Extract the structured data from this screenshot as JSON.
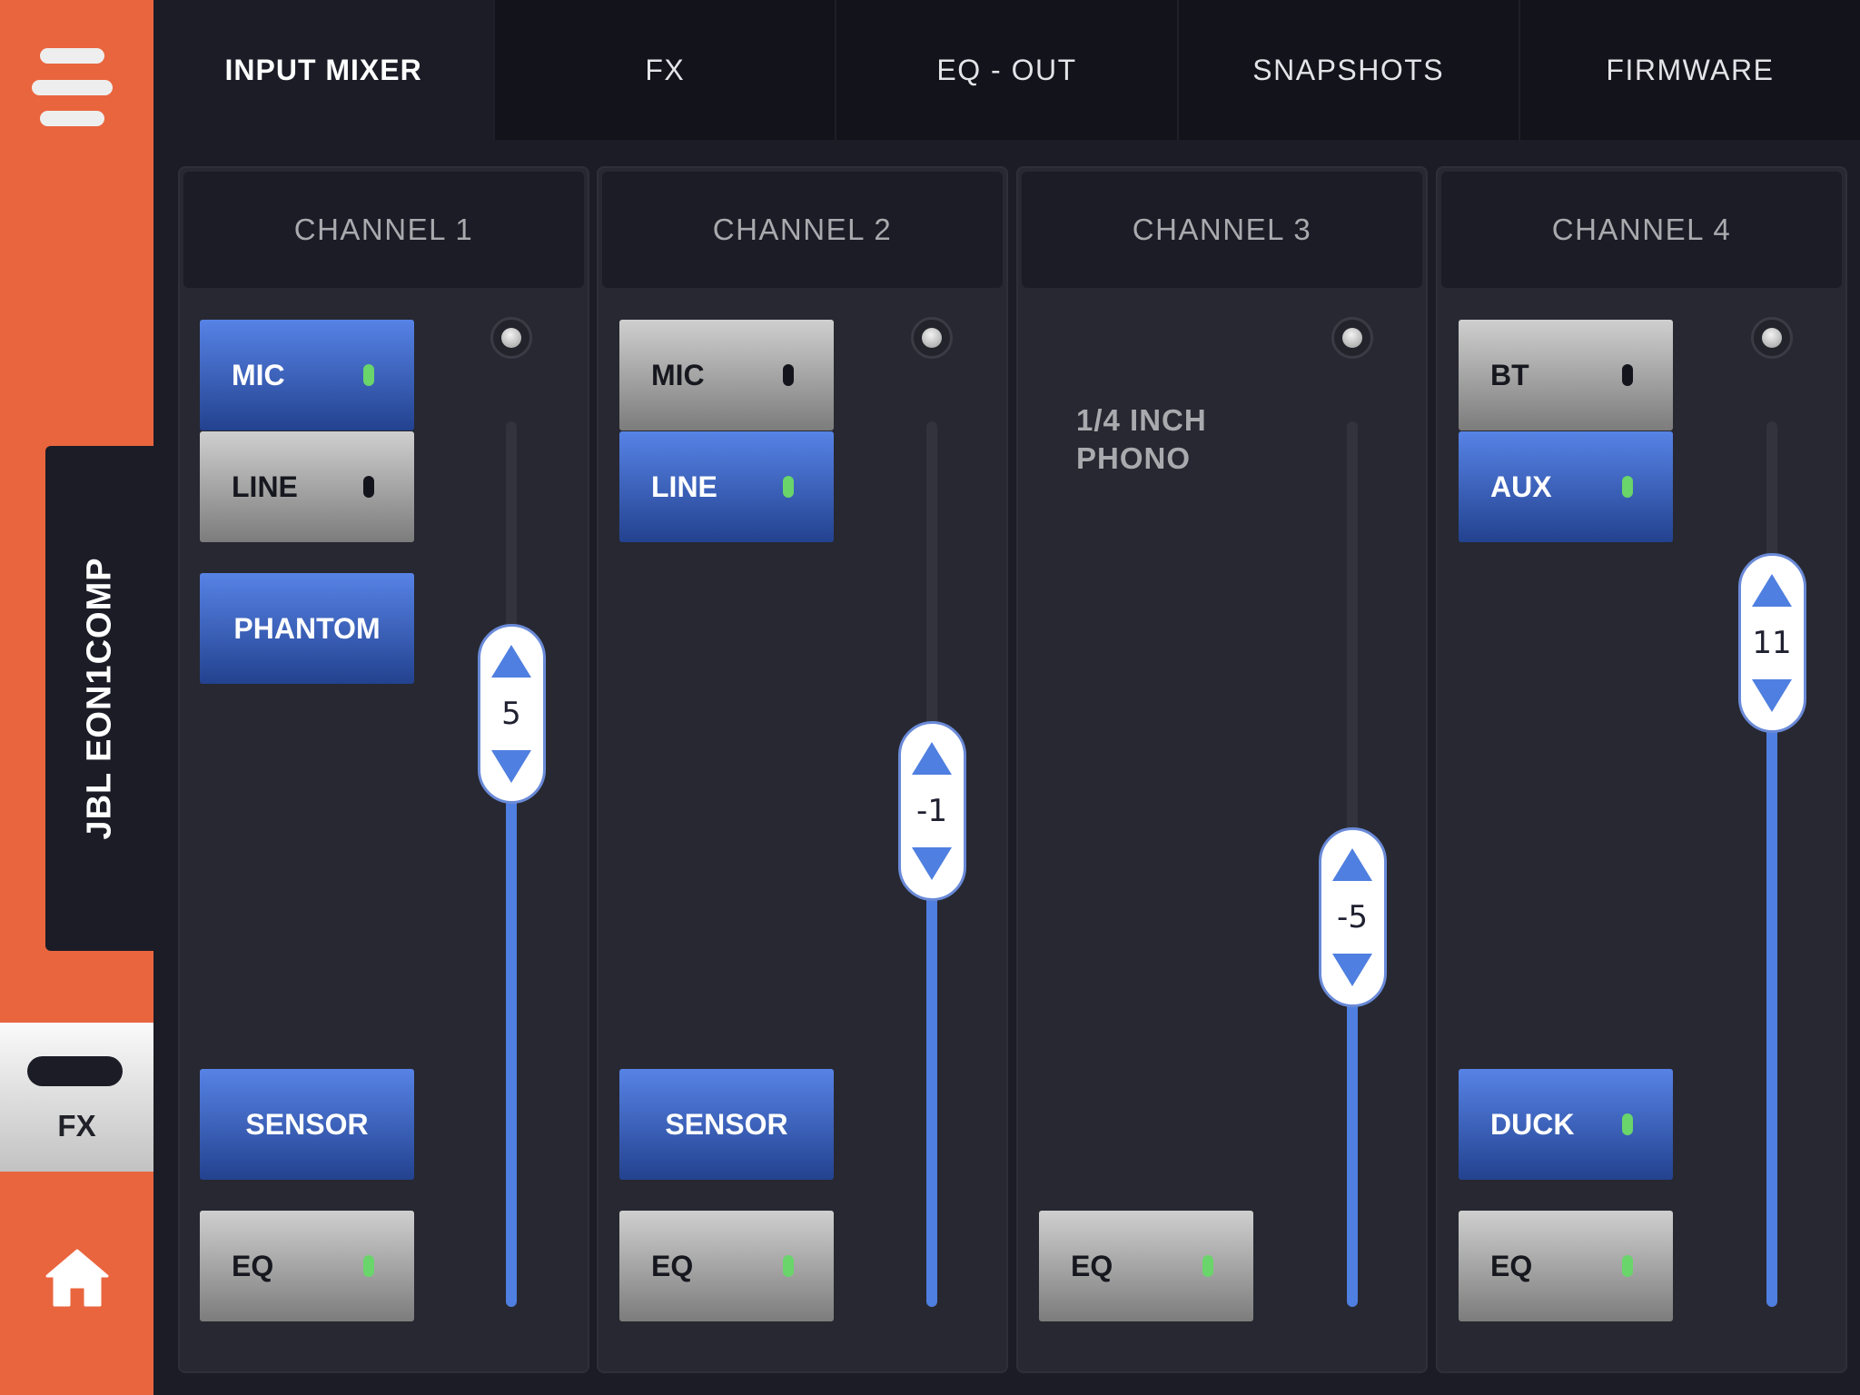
{
  "sidebar": {
    "device_name": "JBL EON1COMP",
    "fx_label": "FX",
    "accent_color": "#e9653e"
  },
  "tabs": [
    {
      "label": "INPUT MIXER",
      "active": true
    },
    {
      "label": "FX",
      "active": false
    },
    {
      "label": "EQ - OUT",
      "active": false
    },
    {
      "label": "SNAPSHOTS",
      "active": false
    },
    {
      "label": "FIRMWARE",
      "active": false
    }
  ],
  "channels": [
    {
      "title": "CHANNEL 1",
      "buttons": {
        "mic": {
          "label": "MIC",
          "on": true
        },
        "line": {
          "label": "LINE",
          "on": false
        },
        "phantom": {
          "label": "PHANTOM",
          "on": true
        },
        "sensor": {
          "label": "SENSOR",
          "on": true
        },
        "eq": {
          "label": "EQ",
          "on": false,
          "led": "green"
        }
      },
      "fader": {
        "value": "5",
        "level_fraction": 0.67
      }
    },
    {
      "title": "CHANNEL 2",
      "buttons": {
        "mic": {
          "label": "MIC",
          "on": false
        },
        "line": {
          "label": "LINE",
          "on": true
        },
        "sensor": {
          "label": "SENSOR",
          "on": true
        },
        "eq": {
          "label": "EQ",
          "on": false,
          "led": "green"
        }
      },
      "fader": {
        "value": "-1",
        "level_fraction": 0.56
      }
    },
    {
      "title": "CHANNEL 3",
      "input_label_line1": "1/4 INCH",
      "input_label_line2": "PHONO",
      "buttons": {
        "eq": {
          "label": "EQ",
          "on": false,
          "led": "green"
        }
      },
      "fader": {
        "value": "-5",
        "level_fraction": 0.44
      }
    },
    {
      "title": "CHANNEL 4",
      "buttons": {
        "bt": {
          "label": "BT",
          "on": false
        },
        "aux": {
          "label": "AUX",
          "on": true
        },
        "duck": {
          "label": "DUCK",
          "on": true
        },
        "eq": {
          "label": "EQ",
          "on": false,
          "led": "green"
        }
      },
      "fader": {
        "value": "11",
        "level_fraction": 0.75
      }
    }
  ],
  "colors": {
    "active_button": "#4f7fe0",
    "led_on": "#69d56a",
    "background": "#1b1c26"
  }
}
